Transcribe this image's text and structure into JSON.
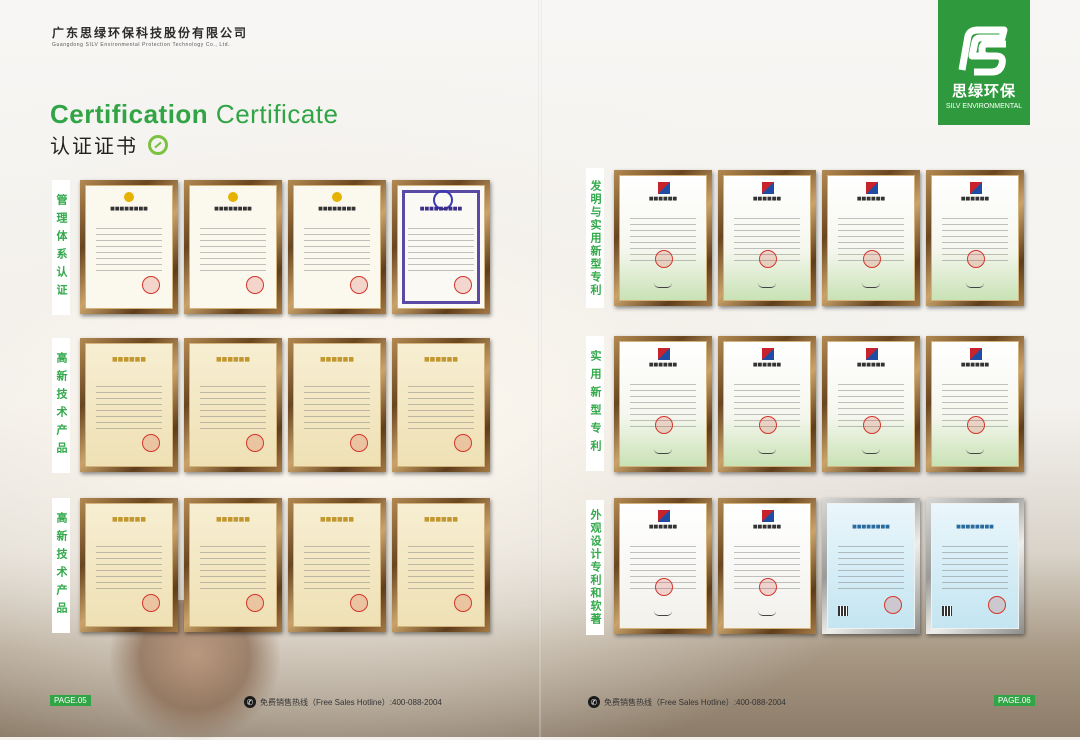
{
  "company": {
    "name_cn": "广东思绿环保科技股份有限公司",
    "name_en": "Guangdong SILV Environmental Protection Technology Co., Ltd."
  },
  "heading": {
    "title_en_bold": "Certification",
    "title_en_light": "Certificate",
    "title_cn": "认证证书"
  },
  "logo": {
    "name_cn": "思绿环保",
    "name_en": "SILV ENVIRONMENTAL",
    "color": "#2f9a3d"
  },
  "accent_color": "#31a446",
  "sections": {
    "left_1": "管理体系认证",
    "left_2": "高新技术产品",
    "left_3": "高新技术产品",
    "right_1": "发明与实用新型专利",
    "right_2": "实用新型专利",
    "right_3": "外观设计专利和软著"
  },
  "certificate_types": {
    "management": "management-system-certificate",
    "ip": "ip-management-certificate",
    "hitech": "high-tech-product-certificate",
    "patent": "patent-certificate",
    "software": "software-copyright-certificate"
  },
  "footer": {
    "left_page": "PAGE.05",
    "right_page": "PAGE.06",
    "hotline": "免费销售热线（Free Sales Hotline）:400-088-2004"
  }
}
